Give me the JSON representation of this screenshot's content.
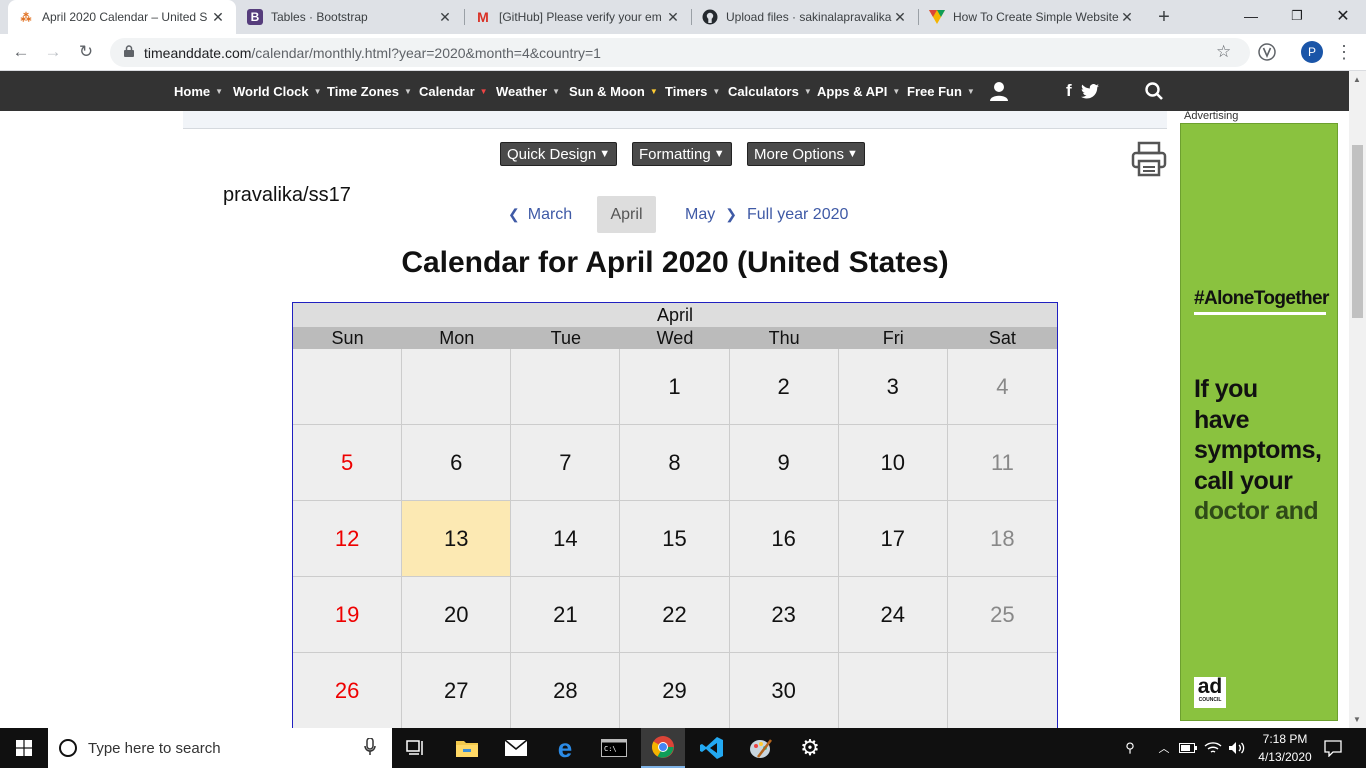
{
  "browser": {
    "tabs": [
      {
        "title": "April 2020 Calendar – United S",
        "active": true
      },
      {
        "title": "Tables · Bootstrap",
        "active": false
      },
      {
        "title": "[GitHub] Please verify your em",
        "active": false
      },
      {
        "title": "Upload files · sakinalapravalika",
        "active": false
      },
      {
        "title": "How To Create Simple Website",
        "active": false
      }
    ],
    "url_host": "timeanddate.com",
    "url_path": "/calendar/monthly.html?year=2020&month=4&country=1",
    "profile_initial": "P"
  },
  "site_nav": {
    "items": [
      "Home",
      "World Clock",
      "Time Zones",
      "Calendar",
      "Weather",
      "Sun & Moon",
      "Timers",
      "Calculators",
      "Apps & API",
      "Free Fun"
    ],
    "social": "f"
  },
  "page": {
    "buttons": {
      "quick_design": "Quick Design",
      "formatting": "Formatting",
      "more_options": "More Options"
    },
    "custom_text": "pravalika/ss17",
    "month_nav": {
      "prev": "March",
      "current": "April",
      "next": "May",
      "full_year": "Full year 2020"
    },
    "title": "Calendar for April 2020 (United States)"
  },
  "calendar": {
    "month": "April",
    "weekdays": [
      "Sun",
      "Mon",
      "Tue",
      "Wed",
      "Thu",
      "Fri",
      "Sat"
    ],
    "rows": [
      [
        "",
        "",
        "",
        "1",
        "2",
        "3",
        "4"
      ],
      [
        "5",
        "6",
        "7",
        "8",
        "9",
        "10",
        "11"
      ],
      [
        "12",
        "13",
        "14",
        "15",
        "16",
        "17",
        "18"
      ],
      [
        "19",
        "20",
        "21",
        "22",
        "23",
        "24",
        "25"
      ],
      [
        "26",
        "27",
        "28",
        "29",
        "30",
        "",
        ""
      ]
    ],
    "highlighted_day": "13"
  },
  "ad": {
    "label": "Advertising",
    "hashtag": "#AloneTogether",
    "line1": "If you",
    "line2": "have",
    "line3": "symptoms,",
    "line4": "call your",
    "line5": "doctor and",
    "logo_text": "ad",
    "logo_sub": "COUNCIL",
    "background": "#8ac23f"
  },
  "taskbar": {
    "search_placeholder": "Type here to search",
    "time": "7:18 PM",
    "date": "4/13/2020"
  }
}
